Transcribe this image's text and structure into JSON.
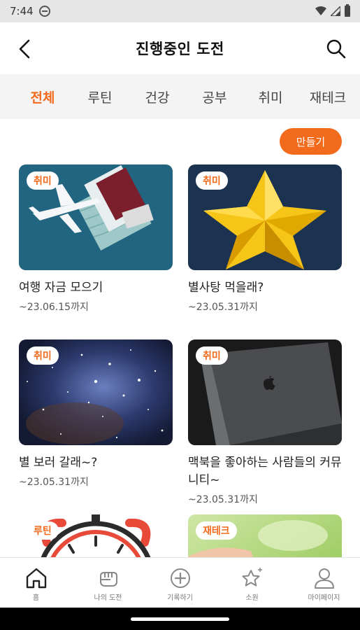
{
  "status": {
    "time": "7:44"
  },
  "header": {
    "title": "진행중인 도전"
  },
  "tabs": [
    {
      "label": "전체",
      "active": true
    },
    {
      "label": "루틴",
      "active": false
    },
    {
      "label": "건강",
      "active": false
    },
    {
      "label": "공부",
      "active": false
    },
    {
      "label": "취미",
      "active": false
    },
    {
      "label": "재테크",
      "active": false
    }
  ],
  "create_button": {
    "label": "만들기"
  },
  "cards": [
    {
      "badge": "취미",
      "title": "여행 자금 모으기",
      "date": "~23.06.15까지",
      "image": "airplane-passport-photo"
    },
    {
      "badge": "취미",
      "title": "별사탕 먹을래?",
      "date": "~23.05.31까지",
      "image": "gold-star-photo"
    },
    {
      "badge": "취미",
      "title": "별 보러 갈래~?",
      "date": "~23.05.31까지",
      "image": "night-sky-photo"
    },
    {
      "badge": "취미",
      "title": "맥북을 좋아하는 사람들의 커뮤니티~",
      "date": "~23.05.31까지",
      "image": "macbook-photo"
    },
    {
      "badge": "루틴",
      "title": "",
      "date": "",
      "image": "alarm-clock-illustration"
    },
    {
      "badge": "재테크",
      "title": "",
      "date": "",
      "image": "hand-green-photo"
    }
  ],
  "bottom_nav": [
    {
      "label": "홈",
      "icon": "home-icon",
      "active": true
    },
    {
      "label": "나의 도전",
      "icon": "fist-icon",
      "active": false
    },
    {
      "label": "기록하기",
      "icon": "plus-circle-icon",
      "active": false
    },
    {
      "label": "소원",
      "icon": "star-icon",
      "active": false
    },
    {
      "label": "마이페이지",
      "icon": "person-icon",
      "active": false
    }
  ],
  "colors": {
    "accent": "#f26b1d",
    "tab_bar_bg": "#f4f4f4",
    "status_bar_bg": "#e6e6e6"
  }
}
